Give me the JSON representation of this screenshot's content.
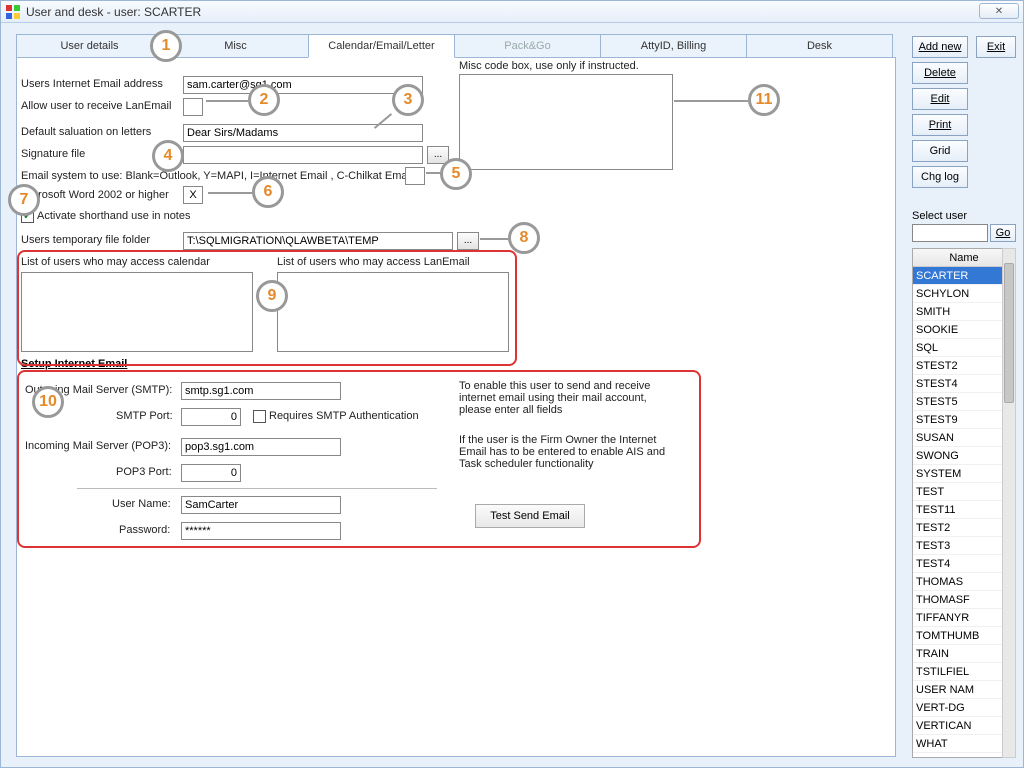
{
  "window": {
    "title": "User and desk - user: SCARTER",
    "close_glyph": "✕"
  },
  "tabs": {
    "user_details": "User details",
    "misc": "Misc",
    "calendar": "Calendar/Email/Letter",
    "packgo": "Pack&Go",
    "attyid": "AttyID, Billing",
    "desk": "Desk"
  },
  "labels": {
    "email_addr": "Users Internet Email address",
    "allow_lanemail": "Allow user to receive LanEmail",
    "salutation": "Default saluation on letters",
    "signature": "Signature file",
    "email_system": "Email system to use: Blank=Outlook, Y=MAPI, I=Internet Email , C-Chilkat Email",
    "word2002": "Microsoft Word 2002 or higher",
    "activate_shorthand": "Activate shorthand use in notes",
    "temp_folder": "Users temporary file folder",
    "access_calendar": "List of users who may access calendar",
    "access_lanemail": "List of users who may access LanEmail",
    "setup_email": "Setup Internet Email",
    "misc_code": "Misc code box, use only if instructed.",
    "smtp_server": "Outgoing Mail Server (SMTP):",
    "smtp_port": "SMTP Port:",
    "requires_auth": "Requires SMTP Authentication",
    "pop3_server": "Incoming Mail Server (POP3):",
    "pop3_port": "POP3 Port:",
    "user_name": "User Name:",
    "password": "Password:",
    "help1": "To enable this user to send and receive internet email using their mail account, please enter all fields",
    "help2": "If the user is the Firm Owner the Internet Email has to be entered to enable AIS and Task scheduler functionality",
    "test_send": "Test Send Email",
    "select_user": "Select user",
    "name_col": "Name"
  },
  "fields": {
    "email_addr": "sam.carter@sg1.com",
    "allow_lanemail": "",
    "salutation": "Dear Sirs/Madams",
    "signature": "",
    "email_system": "",
    "word2002": "X",
    "temp_folder": "T:\\SQLMIGRATION\\QLAWBETA\\TEMP",
    "smtp_server": "smtp.sg1.com",
    "smtp_port": "0",
    "pop3_server": "pop3.sg1.com",
    "pop3_port": "0",
    "user_name": "SamCarter",
    "password": "******",
    "browse": "..."
  },
  "right": {
    "add_new": "Add new",
    "delete": "Delete",
    "edit": "Edit",
    "print": "Print",
    "grid": "Grid",
    "chg_log": "Chg log",
    "exit": "Exit",
    "go": "Go"
  },
  "users": [
    "SCARTER",
    "SCHYLON",
    "SMITH",
    "SOOKIE",
    "SQL",
    "STEST2",
    "STEST4",
    "STEST5",
    "STEST9",
    "SUSAN",
    "SWONG",
    "SYSTEM",
    "TEST",
    "TEST11",
    "TEST2",
    "TEST3",
    "TEST4",
    "THOMAS",
    "THOMASF",
    "TIFFANYR",
    "TOMTHUMB",
    "TRAIN",
    "TSTILFIEL",
    "USER NAM",
    "VERT-DG",
    "VERTICAN",
    "WHAT"
  ],
  "callouts": {
    "1": "1",
    "2": "2",
    "3": "3",
    "4": "4",
    "5": "5",
    "6": "6",
    "7": "7",
    "8": "8",
    "9": "9",
    "10": "10",
    "11": "11"
  }
}
